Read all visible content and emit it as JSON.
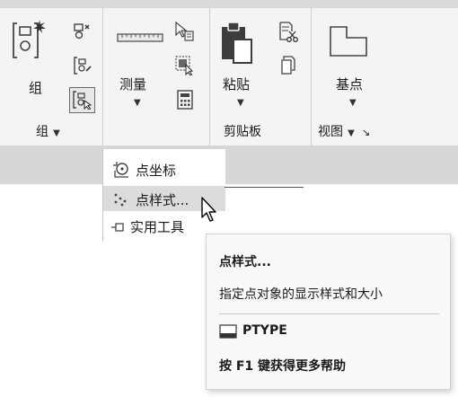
{
  "ribbon": {
    "group_panel": {
      "group_button_label": "组",
      "panel_title": "组"
    },
    "utilities_panel": {
      "measure_button_label": "测量"
    },
    "clipboard_panel": {
      "paste_button_label": "粘贴",
      "panel_title": "剪贴板"
    },
    "view_panel": {
      "basepoint_button_label": "基点",
      "panel_title": "视图",
      "launcher_glyph": "↘"
    }
  },
  "dropdown": {
    "items": [
      {
        "label": "点坐标",
        "icon": "point-coordinates-icon"
      },
      {
        "label": "点样式...",
        "icon": "point-style-icon",
        "selected": true
      },
      {
        "label": "实用工具",
        "icon": "utilities-icon"
      }
    ]
  },
  "tooltip": {
    "title": "点样式...",
    "description": "指定点对象的显示样式和大小",
    "command": "PTYPE",
    "help": "按 F1 键获得更多帮助"
  },
  "colors": {
    "ribbon_bg": "#f4f4f4",
    "bar_bg": "#d6d6d6",
    "selected_item_bg": "#dcdcdc",
    "tooltip_bg": "#f8f8f8"
  }
}
